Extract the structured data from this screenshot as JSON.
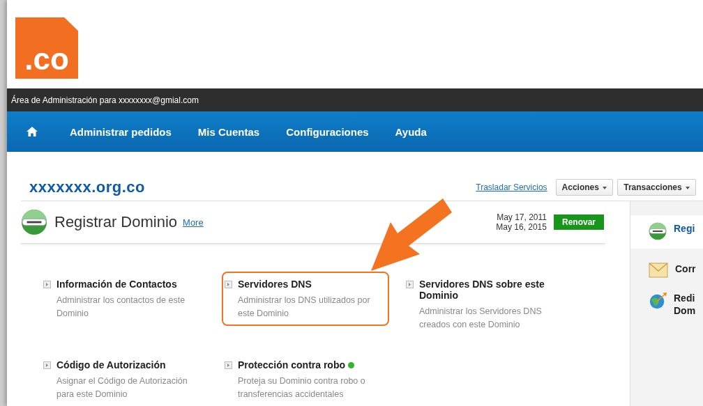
{
  "logo": {
    "text": ".co"
  },
  "admin_bar": {
    "text": "Área de Administración para xxxxxxxx@gmial.com"
  },
  "nav": {
    "items": [
      {
        "label": "Administrar pedidos"
      },
      {
        "label": "Mis Cuentas"
      },
      {
        "label": "Configuraciones"
      },
      {
        "label": "Ayuda"
      }
    ]
  },
  "domain": {
    "name": "xxxxxxx.org.co",
    "link": "Trasladar Servicios",
    "buttons": [
      "Acciones",
      "Transacciones"
    ]
  },
  "section": {
    "title": "Registrar Dominio",
    "more": "More",
    "dates": [
      "May 17, 2011",
      "May 16, 2015"
    ],
    "button": "Renovar"
  },
  "options": [
    {
      "title": "Información de Contactos",
      "description": "Administrar los contactos de este Dominio",
      "highlighted": false
    },
    {
      "title": "Servidores DNS",
      "description": "Administrar los DNS utilizados por este Dominio",
      "highlighted": true
    },
    {
      "title": "Servidores DNS sobre este Dominio",
      "description": "Administrar los Servidores DNS creados con este Dominio",
      "highlighted": false
    },
    {
      "title": "Código de Autorización",
      "description": "Asignar el Código de Autorización para este Dominio",
      "highlighted": false
    },
    {
      "title": "Protección contra robo",
      "description": "Proteja su Dominio contra robo o transferencias accidentales",
      "highlighted": false,
      "color": "#2fb52f"
    }
  ],
  "sidebar": {
    "items": [
      {
        "kind": "globe",
        "label": "Regi"
      },
      {
        "kind": "mail",
        "label": "Corr"
      },
      {
        "kind": "redirect",
        "label": "Redi Dom"
      }
    ]
  }
}
